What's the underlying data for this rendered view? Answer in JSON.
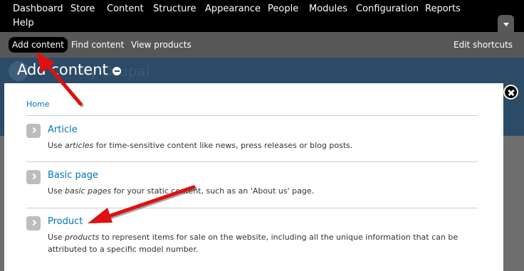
{
  "toolbar": {
    "menu": [
      "Dashboard",
      "Store",
      "Content",
      "Structure",
      "Appearance",
      "People",
      "Modules",
      "Configuration",
      "Reports",
      "Help"
    ],
    "toggle_icon": "chevron-down-icon"
  },
  "shortcuts": {
    "add_content": "Add content",
    "find_content": "Find content",
    "view_products": "View products",
    "edit_shortcuts": "Edit shortcuts"
  },
  "backdrop": {
    "site_name": "My Drupal"
  },
  "overlay": {
    "title": "Add content",
    "breadcrumb_home": "Home",
    "entries": [
      {
        "title": "Article",
        "desc_pre": "Use ",
        "desc_em": "articles",
        "desc_post": " for time-sensitive content like news, press releases or blog posts."
      },
      {
        "title": "Basic page",
        "desc_pre": "Use ",
        "desc_em": "basic pages",
        "desc_post": " for your static content, such as an 'About us' page."
      },
      {
        "title": "Product",
        "desc_pre": "Use ",
        "desc_em": "products",
        "desc_post": " to represent items for sale on the website, including all the unique information that can be attributed to a specific model number."
      }
    ]
  },
  "colors": {
    "link": "#0074bd",
    "annotation_arrow": "#e01010",
    "toolbar": "#000000",
    "shortcut_bar": "#575757"
  }
}
